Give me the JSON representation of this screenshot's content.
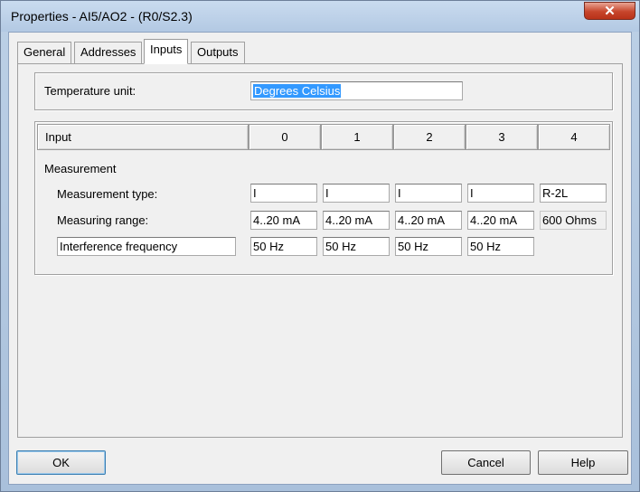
{
  "window": {
    "title": "Properties - AI5/AO2 - (R0/S2.3)",
    "close_glyph": "✕"
  },
  "tabs": [
    {
      "label": "General",
      "active": false
    },
    {
      "label": "Addresses",
      "active": false
    },
    {
      "label": "Inputs",
      "active": true
    },
    {
      "label": "Outputs",
      "active": false
    }
  ],
  "temperature": {
    "label": "Temperature unit:",
    "value": "Degrees Celsius"
  },
  "inputs": {
    "header_label": "Input",
    "channels": [
      "0",
      "1",
      "2",
      "3",
      "4"
    ],
    "measurement_label": "Measurement",
    "measurement_type_label": "Measurement type:",
    "measuring_range_label": "Measuring range:",
    "interference_label": "Interference frequency",
    "measurement_type": [
      "I",
      "I",
      "I",
      "I",
      "R-2L"
    ],
    "measuring_range": [
      "4..20 mA",
      "4..20 mA",
      "4..20 mA",
      "4..20 mA",
      "600 Ohms"
    ],
    "interference": [
      "50 Hz",
      "50 Hz",
      "50 Hz",
      "50 Hz"
    ]
  },
  "buttons": {
    "ok": "OK",
    "cancel": "Cancel",
    "help": "Help"
  }
}
